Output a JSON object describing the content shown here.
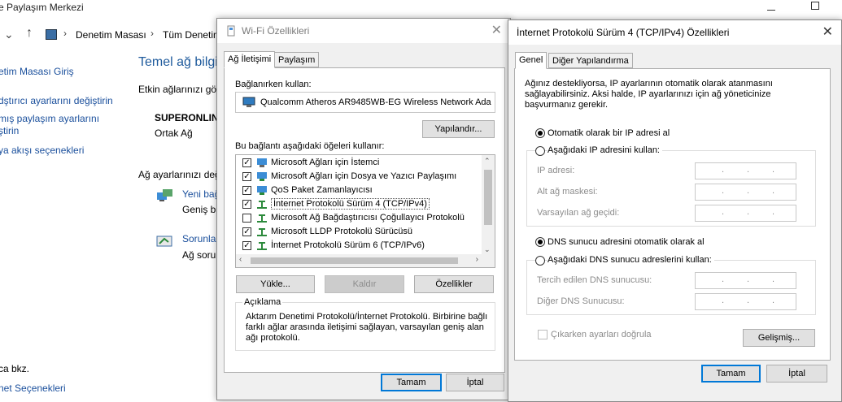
{
  "background": {
    "window_title": "e Paylaşım Merkezi",
    "breadcrumb": [
      "Denetim Masası",
      "Tüm Denetin"
    ],
    "left_links": [
      "etim Masası Giriş",
      "dştırıcı ayarlarını değiştirin",
      "mış paylaşım ayarlarını",
      "ştirin",
      "ya akışı seçenekleri"
    ],
    "left_bottom": [
      "ca bkz.",
      "net Seçenekleri"
    ],
    "main_title": "Temel ağ bilgil",
    "active_networks_label": "Etkin ağlarınızı gör",
    "network_name": "SUPERONLIN",
    "network_type": "Ortak Ağ",
    "change_settings_label": "Ağ ayarlarınızı değ",
    "new_connection_link": "Yeni bağ",
    "new_connection_desc": "Geniş ba",
    "troubleshoot_link": "Sorunlar",
    "troubleshoot_desc": "Ağ sorun"
  },
  "wifi_dialog": {
    "title": "Wi-Fi Özellikleri",
    "tabs": [
      "Ağ İletişimi",
      "Paylaşım"
    ],
    "connect_using_label": "Bağlanırken kullan:",
    "adapter_name": "Qualcomm Atheros AR9485WB-EG Wireless Network Ada",
    "configure_button": "Yapılandır...",
    "items_label": "Bu bağlantı aşağıdaki öğeleri kullanır:",
    "items": [
      {
        "label": "Microsoft Ağları için İstemci",
        "checked": true
      },
      {
        "label": "Microsoft Ağları için Dosya ve Yazıcı Paylaşımı",
        "checked": true
      },
      {
        "label": "QoS Paket Zamanlayıcısı",
        "checked": true
      },
      {
        "label": "İnternet Protokolü Sürüm 4 (TCP/IPv4)",
        "checked": true
      },
      {
        "label": "Microsoft Ağ Bağdaştırıcısı Çoğullayıcı Protokolü",
        "checked": false
      },
      {
        "label": "Microsoft LLDP Protokolü Sürücüsü",
        "checked": true
      },
      {
        "label": "İnternet Protokolü Sürüm 6 (TCP/IPv6)",
        "checked": true
      }
    ],
    "install_button": "Yükle...",
    "uninstall_button": "Kaldır",
    "properties_button": "Özellikler",
    "description_label": "Açıklama",
    "description_text": "Aktarım Denetimi Protokolü/İnternet Protokolü. Birbirine bağlı farklı ağlar arasında iletişimi sağlayan, varsayılan geniş alan ağı protokolü.",
    "ok_button": "Tamam",
    "cancel_button": "İptal"
  },
  "ipv4_dialog": {
    "title": "İnternet Protokolü Sürüm 4 (TCP/IPv4) Özellikleri",
    "tabs": [
      "Genel",
      "Diğer Yapılandırma"
    ],
    "intro_text": "Ağınız destekliyorsa, IP ayarlarının otomatik olarak atanmasını sağlayabilirsiniz. Aksi halde, IP ayarlarınızı için ağ yöneticinize başvurmanız gerekir.",
    "auto_ip_label": "Otomatik olarak bir IP adresi al",
    "manual_ip_label": "Aşağıdaki IP adresini kullan:",
    "ip_address_label": "IP adresi:",
    "subnet_label": "Alt ağ maskesi:",
    "gateway_label": "Varsayılan ağ geçidi:",
    "auto_dns_label": "DNS sunucu adresini otomatik olarak al",
    "manual_dns_label": "Aşağıdaki DNS sunucu adreslerini kullan:",
    "preferred_dns_label": "Tercih edilen DNS sunucusu:",
    "alternate_dns_label": "Diğer DNS Sunucusu:",
    "validate_label": "Çıkarken ayarları doğrula",
    "advanced_button": "Gelişmiş...",
    "ok_button": "Tamam",
    "cancel_button": "İptal",
    "ip_placeholder_dot": "."
  }
}
